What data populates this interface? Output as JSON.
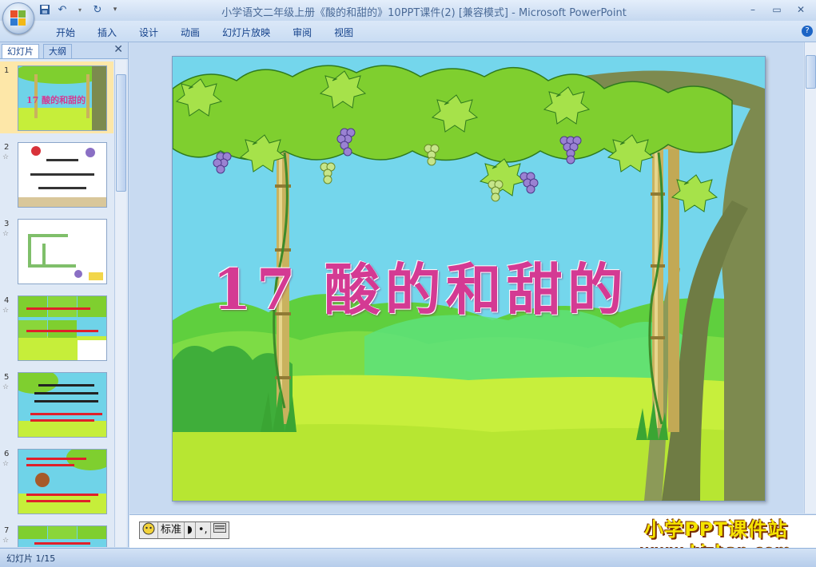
{
  "app": {
    "title": "小学语文二年级上册《酸的和甜的》10PPT课件(2) [兼容模式] - Microsoft PowerPoint"
  },
  "window_controls": {
    "minimize": "–",
    "restore": "▭",
    "close": "✕"
  },
  "ribbon": {
    "tabs": [
      "开始",
      "插入",
      "设计",
      "动画",
      "幻灯片放映",
      "审阅",
      "视图"
    ],
    "help": "?"
  },
  "left_pane": {
    "tabs": [
      "幻灯片",
      "大纲"
    ],
    "close": "✕",
    "selected_slide": 1,
    "slides": [
      {
        "number": "1",
        "star": ""
      },
      {
        "number": "2",
        "star": "☆"
      },
      {
        "number": "3",
        "star": "☆"
      },
      {
        "number": "4",
        "star": "☆"
      },
      {
        "number": "5",
        "star": "☆"
      },
      {
        "number": "6",
        "star": "☆"
      },
      {
        "number": "7",
        "star": "☆"
      }
    ]
  },
  "slide": {
    "title": "17  酸的和甜的"
  },
  "thumb_titles": {
    "s1": "17 酸的和甜的"
  },
  "ime": {
    "mode": "标准"
  },
  "watermark": {
    "line1": "小学PPT课件站",
    "line2": "www.kjzhan.com"
  },
  "status": {
    "slide_counter": "幻灯片 1/15"
  },
  "colors": {
    "title_pink": "#d43a93",
    "sky": "#6fd3e8",
    "grass": "#c6ee3a",
    "leaf": "#7fcf2f",
    "grape": "#8a6fc4"
  }
}
